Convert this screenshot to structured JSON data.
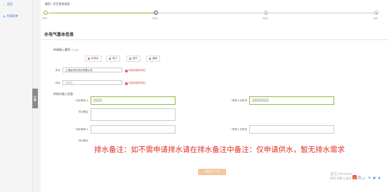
{
  "sidebar": {
    "back_label": "返回",
    "menu_item_label": "申请表单",
    "collapse_label": "折叠"
  },
  "breadcrumb": {
    "home": "首页",
    "separator": "/",
    "current": "项目报建填报"
  },
  "steps": [
    {
      "number": "✓",
      "label": "步骤一"
    },
    {
      "number": "2",
      "label": "步骤二"
    },
    {
      "number": "3",
      "label": "步骤三"
    },
    {
      "number": "4",
      "label": "完成"
    }
  ],
  "section_title": "水电气基本信息",
  "apply_section": {
    "label": "申请接入事项",
    "hint": "(可多选)",
    "options": [
      {
        "label": "供排水",
        "checked": true
      },
      {
        "label": "电力",
        "checked": false
      },
      {
        "label": "燃气",
        "checked": false
      },
      {
        "label": "通信",
        "checked": false
      }
    ]
  },
  "fields": {
    "water_supplier_label": "供水",
    "water_supplier_value": "上海自来水供水有限公司",
    "water_warning": "请选择服务单位",
    "drainage_label": "排水",
    "drainage_placeholder": "请选择",
    "drainage_warning": "请选择服务单位"
  },
  "access_info": {
    "title": "供排水接入信息",
    "supply_contact_label": "* 供水联系人",
    "supply_phone_label": "* 联系人手机号",
    "supply_note_label": "供水备注",
    "drain_contact_label": "* 排水联系人",
    "drain_phone_label": "* 联系人手机号",
    "drain_note_label": "排水备注"
  },
  "annotation": "排水备注：如不需申请排水请在排水备注中备注：仅申请供水，暂无排水需求",
  "next_button": "保存并下一步",
  "watermark": {
    "line1": "激活 Windows",
    "line2": "转到\"设置\"以激活 Windows。"
  },
  "tray": [
    "S",
    "中",
    "♪",
    "⚙",
    "▦",
    "♟"
  ],
  "colors": {
    "accent": "#3a7bd5",
    "step_active": "#8fbf3f",
    "warning": "#d9534f",
    "annotation": "#e0302a"
  }
}
